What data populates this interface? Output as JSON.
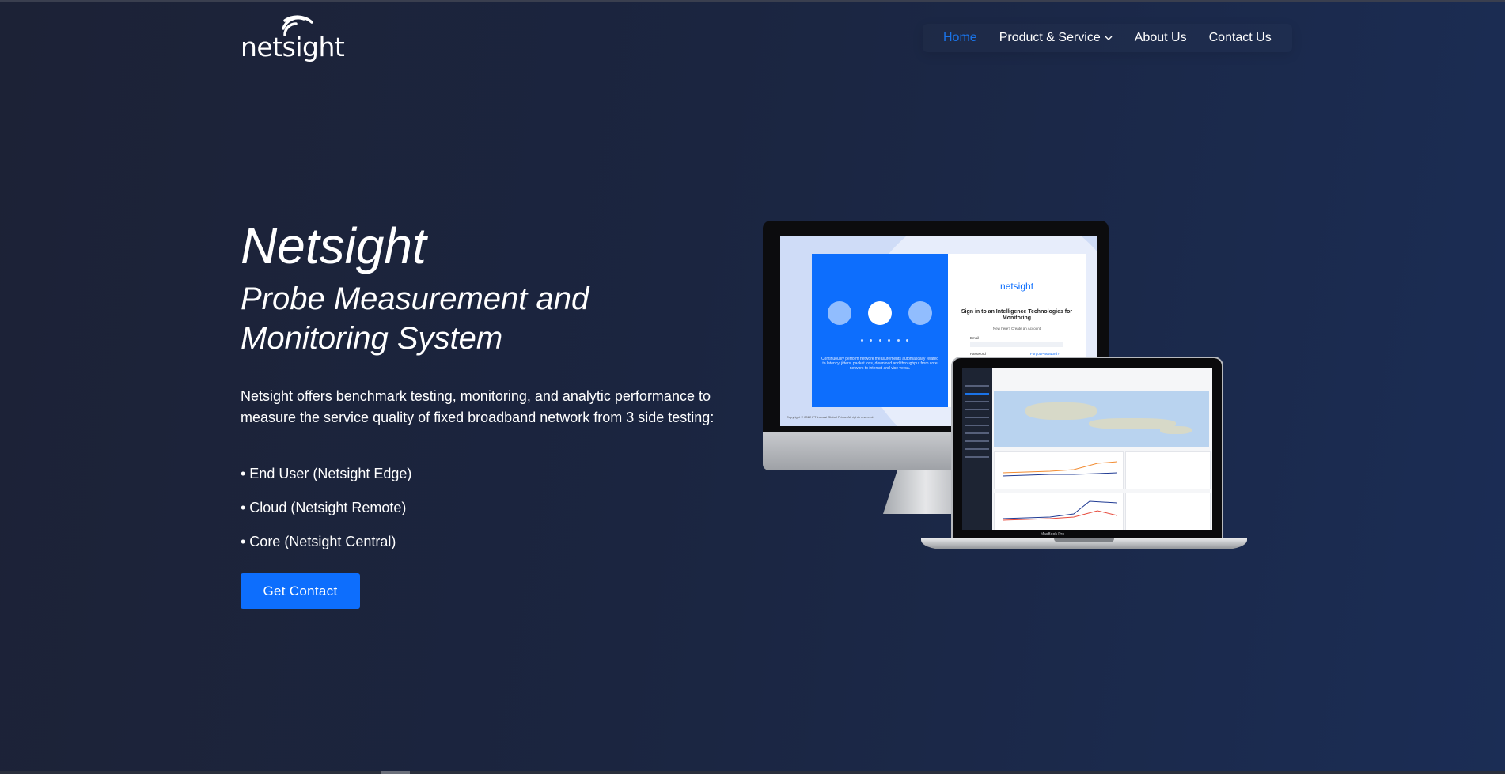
{
  "header": {
    "logo_text": "netsight",
    "nav": [
      {
        "label": "Home",
        "active": true
      },
      {
        "label": "Product & Service",
        "dropdown": true
      },
      {
        "label": "About Us"
      },
      {
        "label": "Contact Us"
      }
    ]
  },
  "hero": {
    "title": "Netsight",
    "subtitle": "Probe Measurement and Monitoring System",
    "description": "Netsight offers benchmark testing, monitoring, and analytic performance to measure the service quality of fixed broadband network from 3 side testing:",
    "bullets": [
      "• End User (Netsight Edge)",
      "• Cloud (Netsight Remote)",
      "• Core (Netsight Central)"
    ],
    "cta_label": "Get Contact"
  },
  "devices": {
    "imac_logo": "netsight",
    "imac_title": "Sign in to an Intelligence Technologies for Monitoring",
    "imac_sub": "New here? Create an Account",
    "imac_email_label": "Email",
    "imac_password_label": "Password",
    "imac_forgot": "Forgot Password?",
    "imac_caption": "Continuously perform network measurements automatically related to latency, jitters, packet loss, download and throughput from core network to internet and vice versa.",
    "imac_copyright": "Copyright © 2022 PT Inovasi Global Prima. All rights reserved.",
    "macbook_brand": "MacBook Pro"
  },
  "colors": {
    "accent": "#0d6efd",
    "nav_active": "#1a73e8",
    "bg_start": "#1c2236",
    "bg_end": "#1b2d55"
  }
}
